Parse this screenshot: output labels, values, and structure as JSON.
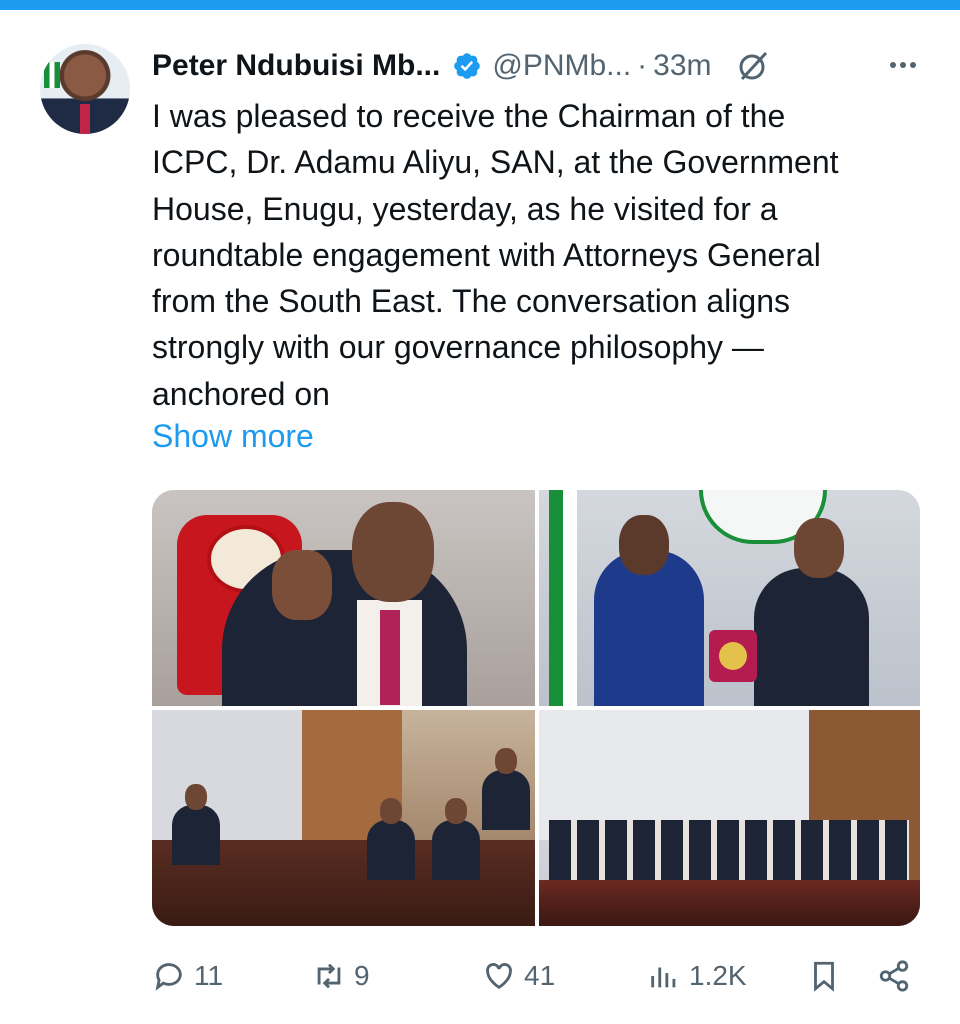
{
  "tweet": {
    "author_name": "Peter Ndubuisi Mb...",
    "handle": "@PNMb...",
    "separator": "·",
    "time": "33m",
    "text": "I was pleased to receive the Chairman of the\nICPC, Dr. Adamu Aliyu, SAN, at the Government\nHouse, Enugu, yesterday, as he visited for a\nroundtable engagement with Attorneys General\nfrom the South East. The conversation aligns\nstrongly with our governance philosophy —\nanchored on",
    "show_more": "Show more"
  },
  "actions": {
    "replies": "11",
    "reposts": "9",
    "likes": "41",
    "views": "1.2K"
  },
  "icons": [
    "verified-badge-icon",
    "grok-icon",
    "more-options-icon",
    "reply-icon",
    "repost-icon",
    "like-icon",
    "views-icon",
    "bookmark-icon",
    "share-icon"
  ],
  "colors": {
    "accent": "#1d9bf0",
    "text": "#0f1419",
    "secondary": "#536471"
  }
}
